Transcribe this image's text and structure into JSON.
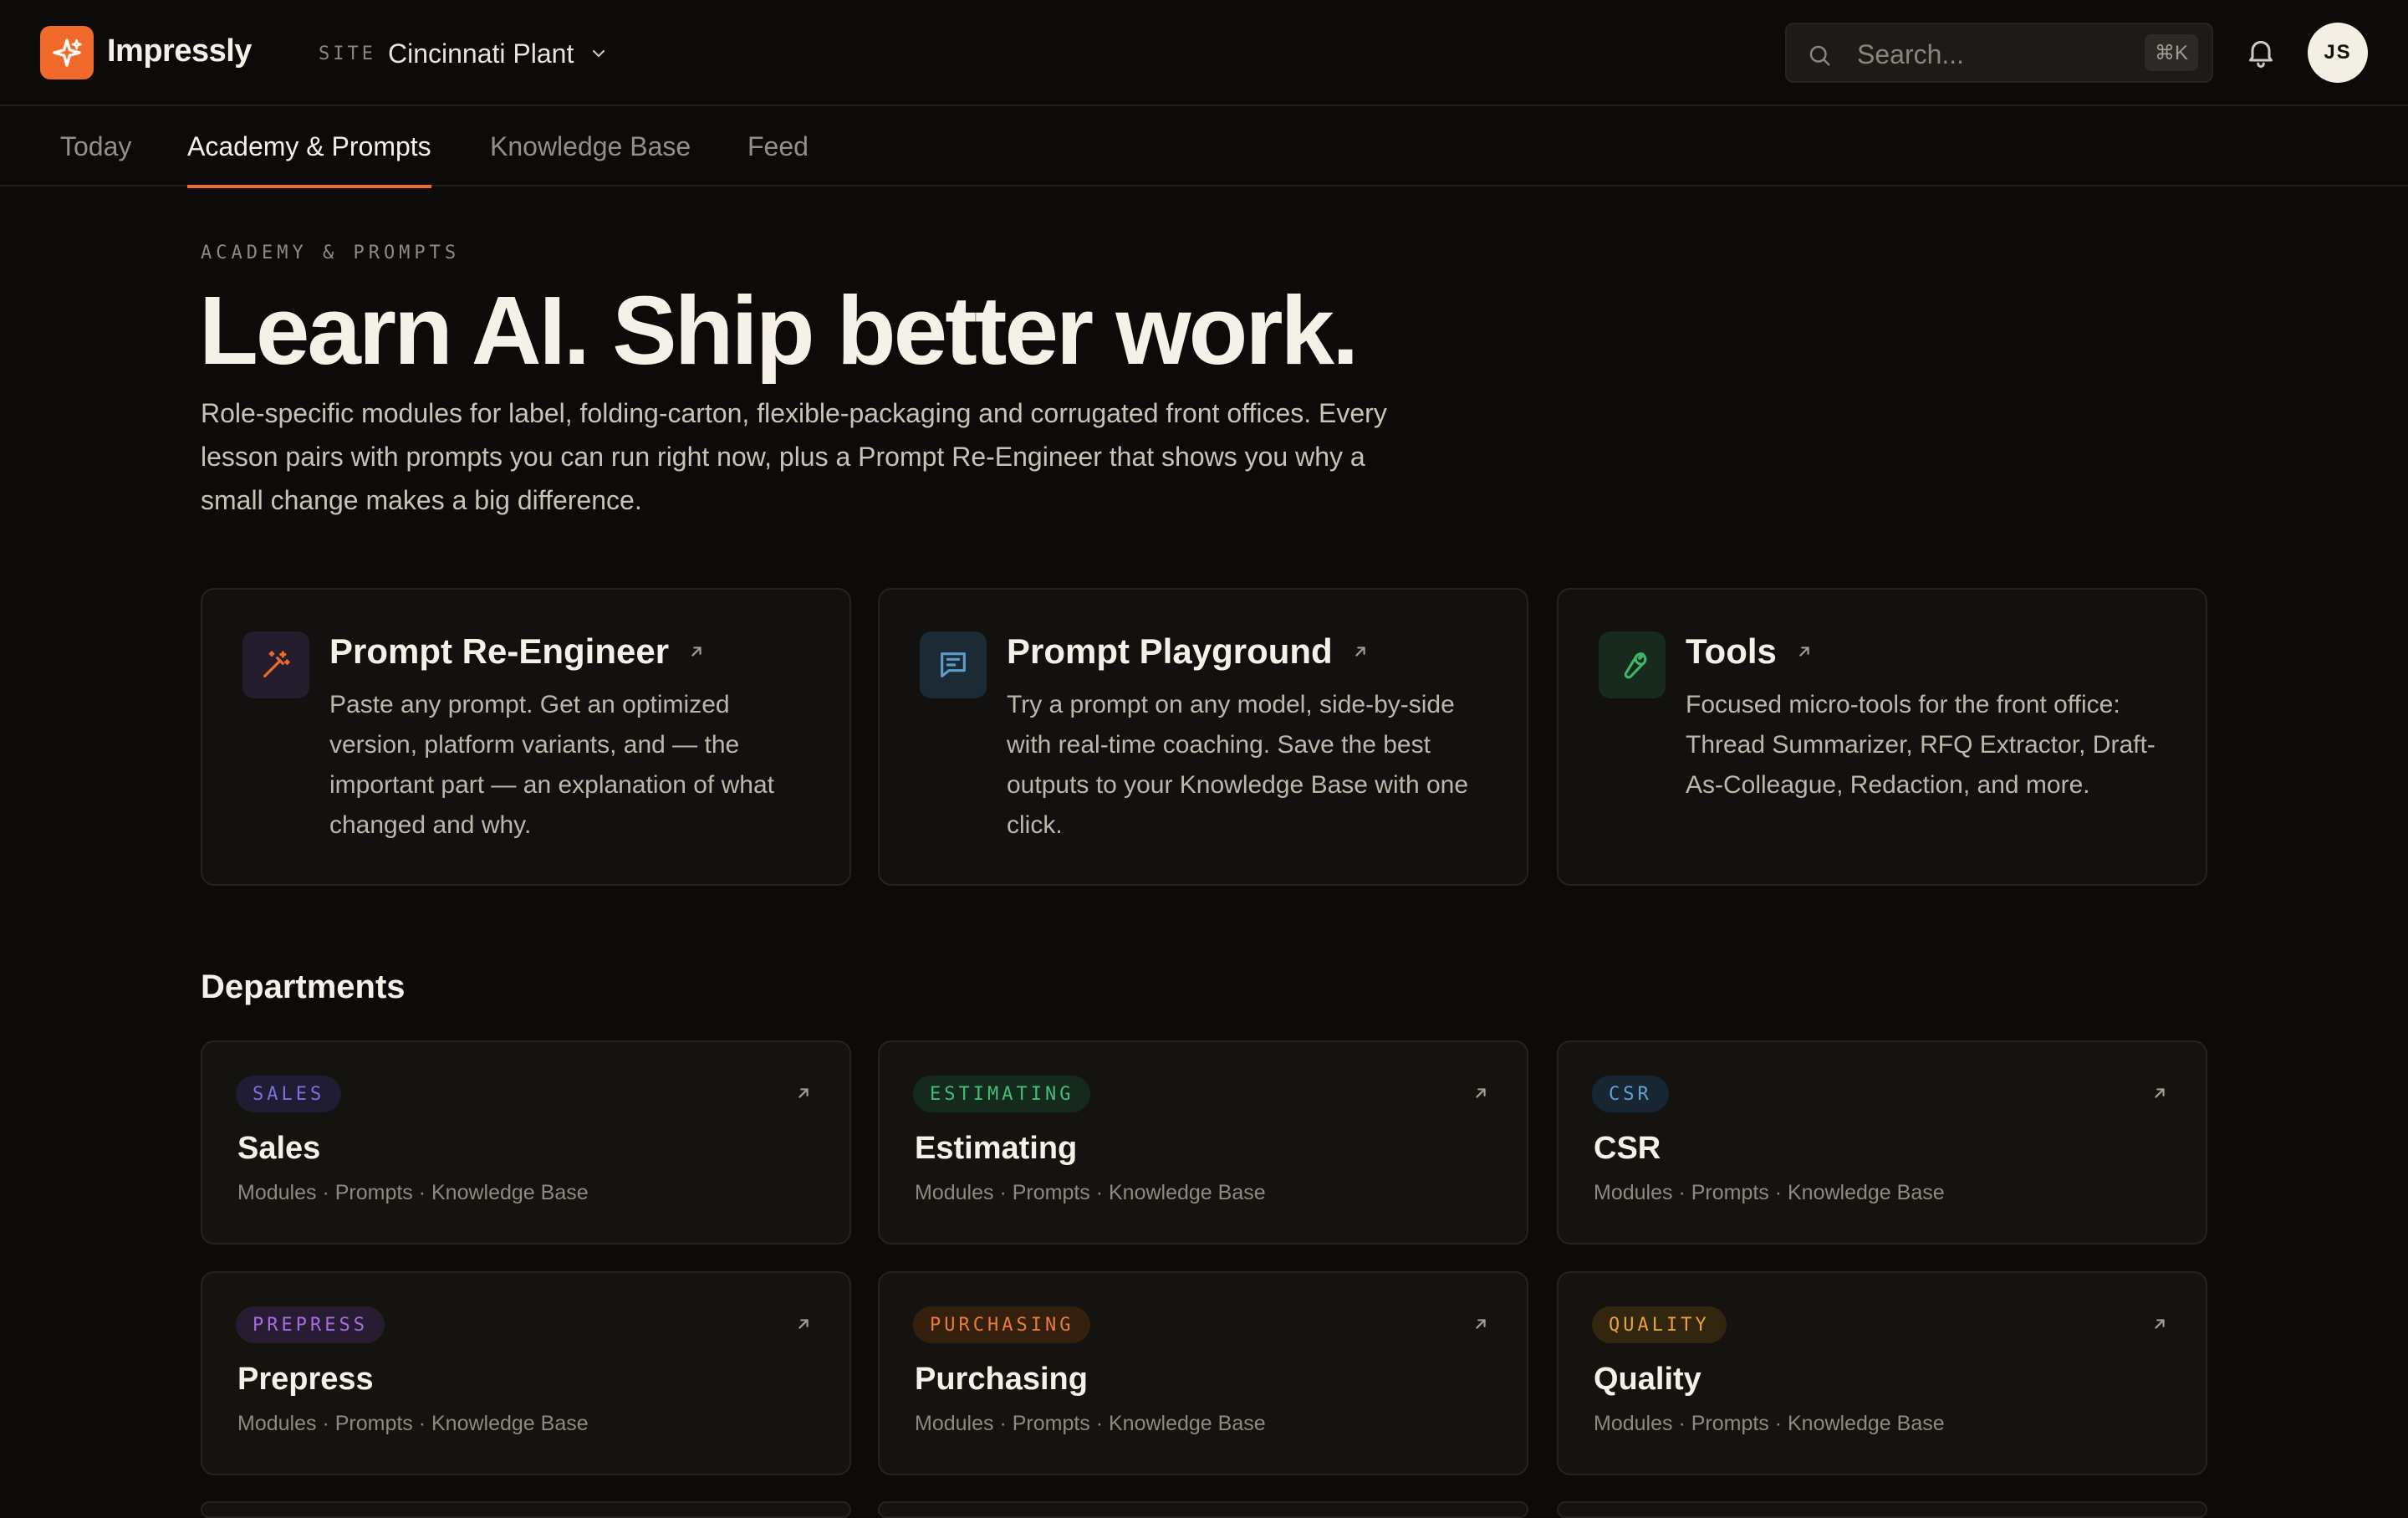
{
  "app": {
    "brand": "Impressly",
    "site_label": "SITE",
    "site_value": "Cincinnati Plant",
    "search_placeholder": "Search...",
    "search_shortcut": "⌘K",
    "avatar_initials": "JS",
    "accent": "#f26a2b"
  },
  "tabs": [
    {
      "label": "Today"
    },
    {
      "label": "Academy & Prompts",
      "active": true
    },
    {
      "label": "Knowledge Base"
    },
    {
      "label": "Feed"
    }
  ],
  "hero": {
    "eyebrow": "ACADEMY & PROMPTS",
    "title": "Learn AI. Ship better work.",
    "description": "Role-specific modules for label, folding-carton, flexible-packaging and corrugated front offices. Every lesson pairs with prompts you can run right now, plus a Prompt Re-Engineer that shows you why a small change makes a big difference."
  },
  "features": [
    {
      "title": "Prompt Re-Engineer",
      "description": "Paste any prompt. Get an optimized version, platform variants, and — the important part — an explanation of what changed and why.",
      "icon": "magic-wand-icon",
      "color": "#f26a2b"
    },
    {
      "title": "Prompt Playground",
      "description": "Try a prompt on any model, side-by-side with real-time coaching. Save the best outputs to your Knowledge Base with one click.",
      "icon": "chat-icon",
      "color": "#5b9cc9"
    },
    {
      "title": "Tools",
      "description": "Focused micro-tools for the front office: Thread Summarizer, RFQ Extractor, Draft-As-Colleague, Redaction, and more.",
      "icon": "wrench-icon",
      "color": "#3fb56a"
    }
  ],
  "departments": {
    "title": "Departments",
    "items": [
      {
        "badge": "SALES",
        "name": "Sales",
        "meta": "Modules · Prompts · Knowledge Base",
        "color": "#7b72e0",
        "bg": "#1f1c33"
      },
      {
        "badge": "ESTIMATING",
        "name": "Estimating",
        "meta": "Modules · Prompts · Knowledge Base",
        "color": "#3fbf78",
        "bg": "#16291d"
      },
      {
        "badge": "CSR",
        "name": "CSR",
        "meta": "Modules · Prompts · Knowledge Base",
        "color": "#5ea3d2",
        "bg": "#172632"
      },
      {
        "badge": "PREPRESS",
        "name": "Prepress",
        "meta": "Modules · Prompts · Knowledge Base",
        "color": "#a56ee0",
        "bg": "#281c33"
      },
      {
        "badge": "PURCHASING",
        "name": "Purchasing",
        "meta": "Modules · Prompts · Knowledge Base",
        "color": "#ee7a38",
        "bg": "#33200f"
      },
      {
        "badge": "QUALITY",
        "name": "Quality",
        "meta": "Modules · Prompts · Knowledge Base",
        "color": "#e3a43c",
        "bg": "#33260f"
      }
    ]
  }
}
